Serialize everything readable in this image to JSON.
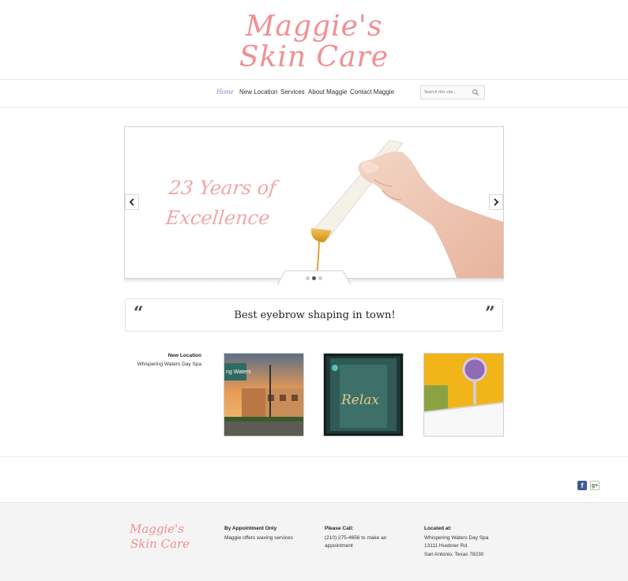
{
  "logo": {
    "line1": "Maggie's",
    "line2": "Skin Care"
  },
  "nav": {
    "items": [
      {
        "label": "Home"
      },
      {
        "label": "New Location"
      },
      {
        "label": "Services"
      },
      {
        "label": "About Maggie"
      },
      {
        "label": "Contact Maggie"
      }
    ],
    "active": "Home"
  },
  "search": {
    "placeholder": "Search this site..."
  },
  "slider": {
    "line1": "23 Years of",
    "line2": "Excellence",
    "slide_count": 3,
    "active_slide": 2
  },
  "quote": {
    "text": "Best eyebrow shaping in town!",
    "open": "“",
    "close": "”"
  },
  "new_location": {
    "title": "New Location",
    "subtitle": "Whispering Waters Day Spa"
  },
  "thumbnails": [
    {
      "icon": "spa-building-photo",
      "sign": "ng Waters"
    },
    {
      "icon": "relax-glass-door-photo",
      "sign": "Relax"
    },
    {
      "icon": "bathtub-photo"
    }
  ],
  "social": [
    {
      "icon": "facebook-icon",
      "glyph": "f"
    },
    {
      "icon": "google-plus-icon",
      "glyph": "g+"
    }
  ],
  "footer": {
    "logo_line1": "Maggie's",
    "logo_line2": "Skin Care",
    "col1": {
      "heading": "By Appointment Only",
      "lines": [
        "Maggie offers waxing services"
      ]
    },
    "col2": {
      "heading": "Please Call:",
      "lines": [
        "(210) 275-4656 to make an",
        "appointment"
      ]
    },
    "col3": {
      "heading": "Located at:",
      "lines": [
        "Whispering Waters Day Spa",
        "13111 Huebner Rd.",
        "San Antonio, Texas 78230"
      ]
    }
  },
  "colors": {
    "brand_pink": "#f08f92",
    "nav_active": "#a77ec0",
    "footer_bg": "#f4f4f4"
  }
}
